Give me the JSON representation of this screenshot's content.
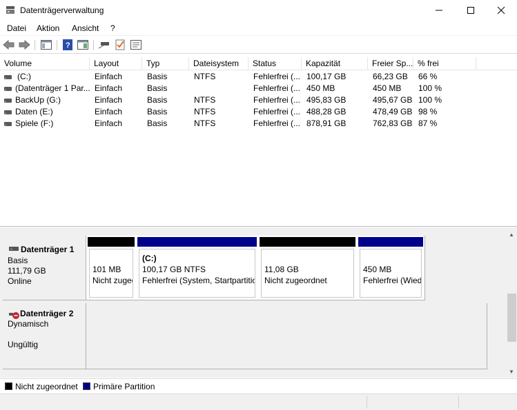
{
  "window": {
    "title": "Datenträgerverwaltung",
    "minimize_glyph": "—",
    "maximize_glyph": "☐",
    "close_glyph": "✕"
  },
  "menu": {
    "items": [
      "Datei",
      "Aktion",
      "Ansicht",
      "?"
    ]
  },
  "toolbar": {
    "icons": [
      "back-arrow-icon",
      "forward-arrow-icon",
      "console-tree-icon",
      "help-icon",
      "show-pane-icon",
      "connect-disk-icon",
      "checklist-icon",
      "properties-icon"
    ]
  },
  "volume_list": {
    "columns": [
      "Volume",
      "Layout",
      "Typ",
      "Dateisystem",
      "Status",
      "Kapazität",
      "Freier Sp...",
      "% frei"
    ],
    "rows": [
      [
        "(C:)",
        "Einfach",
        "Basis",
        "NTFS",
        "Fehlerfrei (...",
        "100,17 GB",
        "66,23 GB",
        "66 %"
      ],
      [
        "(Datenträger 1 Par...",
        "Einfach",
        "Basis",
        "",
        "Fehlerfrei (...",
        "450 MB",
        "450 MB",
        "100 %"
      ],
      [
        "BackUp (G:)",
        "Einfach",
        "Basis",
        "NTFS",
        "Fehlerfrei (...",
        "495,83 GB",
        "495,67 GB",
        "100 %"
      ],
      [
        "Daten (E:)",
        "Einfach",
        "Basis",
        "NTFS",
        "Fehlerfrei (...",
        "488,28 GB",
        "478,49 GB",
        "98 %"
      ],
      [
        "Spiele (F:)",
        "Einfach",
        "Basis",
        "NTFS",
        "Fehlerfrei (...",
        "878,91 GB",
        "762,83 GB",
        "87 %"
      ]
    ]
  },
  "disks": {
    "disk1": {
      "name": "Datenträger 1",
      "type": "Basis",
      "size": "111,79 GB",
      "state": "Online",
      "partitions": [
        {
          "title": "",
          "line1": "101 MB",
          "line2": "Nicht zugeordnet",
          "bar_color": "#000000"
        },
        {
          "title": "(C:)",
          "line1": "100,17 GB NTFS",
          "line2": "Fehlerfrei (System, Startpartition)",
          "bar_color": "#00008b"
        },
        {
          "title": "",
          "line1": "11,08 GB",
          "line2": "Nicht zugeordnet",
          "bar_color": "#000000"
        },
        {
          "title": "",
          "line1": "450 MB",
          "line2": "Fehlerfrei (Wiederherstellung)",
          "bar_color": "#00008b"
        }
      ]
    },
    "disk2": {
      "name": "Datenträger 2",
      "type": "Dynamisch",
      "state": "Ungültig"
    }
  },
  "legend": {
    "items": [
      {
        "label": "Nicht zugeordnet",
        "color": "#000000"
      },
      {
        "label": "Primäre Partition",
        "color": "#00008b"
      }
    ]
  },
  "scrollbar": {
    "up_glyph": "▲",
    "down_glyph": "▼"
  }
}
